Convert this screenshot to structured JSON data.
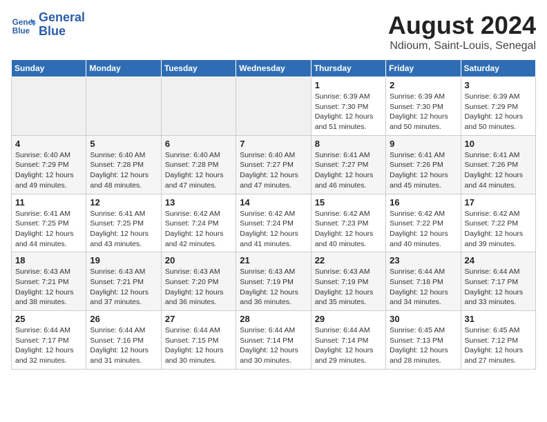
{
  "logo": {
    "line1": "General",
    "line2": "Blue"
  },
  "title": "August 2024",
  "subtitle": "Ndioum, Saint-Louis, Senegal",
  "days_of_week": [
    "Sunday",
    "Monday",
    "Tuesday",
    "Wednesday",
    "Thursday",
    "Friday",
    "Saturday"
  ],
  "weeks": [
    [
      {
        "num": "",
        "info": "",
        "empty": true
      },
      {
        "num": "",
        "info": "",
        "empty": true
      },
      {
        "num": "",
        "info": "",
        "empty": true
      },
      {
        "num": "",
        "info": "",
        "empty": true
      },
      {
        "num": "1",
        "info": "Sunrise: 6:39 AM\nSunset: 7:30 PM\nDaylight: 12 hours\nand 51 minutes."
      },
      {
        "num": "2",
        "info": "Sunrise: 6:39 AM\nSunset: 7:30 PM\nDaylight: 12 hours\nand 50 minutes."
      },
      {
        "num": "3",
        "info": "Sunrise: 6:39 AM\nSunset: 7:29 PM\nDaylight: 12 hours\nand 50 minutes."
      }
    ],
    [
      {
        "num": "4",
        "info": "Sunrise: 6:40 AM\nSunset: 7:29 PM\nDaylight: 12 hours\nand 49 minutes."
      },
      {
        "num": "5",
        "info": "Sunrise: 6:40 AM\nSunset: 7:28 PM\nDaylight: 12 hours\nand 48 minutes."
      },
      {
        "num": "6",
        "info": "Sunrise: 6:40 AM\nSunset: 7:28 PM\nDaylight: 12 hours\nand 47 minutes."
      },
      {
        "num": "7",
        "info": "Sunrise: 6:40 AM\nSunset: 7:27 PM\nDaylight: 12 hours\nand 47 minutes."
      },
      {
        "num": "8",
        "info": "Sunrise: 6:41 AM\nSunset: 7:27 PM\nDaylight: 12 hours\nand 46 minutes."
      },
      {
        "num": "9",
        "info": "Sunrise: 6:41 AM\nSunset: 7:26 PM\nDaylight: 12 hours\nand 45 minutes."
      },
      {
        "num": "10",
        "info": "Sunrise: 6:41 AM\nSunset: 7:26 PM\nDaylight: 12 hours\nand 44 minutes."
      }
    ],
    [
      {
        "num": "11",
        "info": "Sunrise: 6:41 AM\nSunset: 7:25 PM\nDaylight: 12 hours\nand 44 minutes."
      },
      {
        "num": "12",
        "info": "Sunrise: 6:41 AM\nSunset: 7:25 PM\nDaylight: 12 hours\nand 43 minutes."
      },
      {
        "num": "13",
        "info": "Sunrise: 6:42 AM\nSunset: 7:24 PM\nDaylight: 12 hours\nand 42 minutes."
      },
      {
        "num": "14",
        "info": "Sunrise: 6:42 AM\nSunset: 7:24 PM\nDaylight: 12 hours\nand 41 minutes."
      },
      {
        "num": "15",
        "info": "Sunrise: 6:42 AM\nSunset: 7:23 PM\nDaylight: 12 hours\nand 40 minutes."
      },
      {
        "num": "16",
        "info": "Sunrise: 6:42 AM\nSunset: 7:22 PM\nDaylight: 12 hours\nand 40 minutes."
      },
      {
        "num": "17",
        "info": "Sunrise: 6:42 AM\nSunset: 7:22 PM\nDaylight: 12 hours\nand 39 minutes."
      }
    ],
    [
      {
        "num": "18",
        "info": "Sunrise: 6:43 AM\nSunset: 7:21 PM\nDaylight: 12 hours\nand 38 minutes."
      },
      {
        "num": "19",
        "info": "Sunrise: 6:43 AM\nSunset: 7:21 PM\nDaylight: 12 hours\nand 37 minutes."
      },
      {
        "num": "20",
        "info": "Sunrise: 6:43 AM\nSunset: 7:20 PM\nDaylight: 12 hours\nand 36 minutes."
      },
      {
        "num": "21",
        "info": "Sunrise: 6:43 AM\nSunset: 7:19 PM\nDaylight: 12 hours\nand 36 minutes."
      },
      {
        "num": "22",
        "info": "Sunrise: 6:43 AM\nSunset: 7:19 PM\nDaylight: 12 hours\nand 35 minutes."
      },
      {
        "num": "23",
        "info": "Sunrise: 6:44 AM\nSunset: 7:18 PM\nDaylight: 12 hours\nand 34 minutes."
      },
      {
        "num": "24",
        "info": "Sunrise: 6:44 AM\nSunset: 7:17 PM\nDaylight: 12 hours\nand 33 minutes."
      }
    ],
    [
      {
        "num": "25",
        "info": "Sunrise: 6:44 AM\nSunset: 7:17 PM\nDaylight: 12 hours\nand 32 minutes."
      },
      {
        "num": "26",
        "info": "Sunrise: 6:44 AM\nSunset: 7:16 PM\nDaylight: 12 hours\nand 31 minutes."
      },
      {
        "num": "27",
        "info": "Sunrise: 6:44 AM\nSunset: 7:15 PM\nDaylight: 12 hours\nand 30 minutes."
      },
      {
        "num": "28",
        "info": "Sunrise: 6:44 AM\nSunset: 7:14 PM\nDaylight: 12 hours\nand 30 minutes."
      },
      {
        "num": "29",
        "info": "Sunrise: 6:44 AM\nSunset: 7:14 PM\nDaylight: 12 hours\nand 29 minutes."
      },
      {
        "num": "30",
        "info": "Sunrise: 6:45 AM\nSunset: 7:13 PM\nDaylight: 12 hours\nand 28 minutes."
      },
      {
        "num": "31",
        "info": "Sunrise: 6:45 AM\nSunset: 7:12 PM\nDaylight: 12 hours\nand 27 minutes."
      }
    ]
  ]
}
